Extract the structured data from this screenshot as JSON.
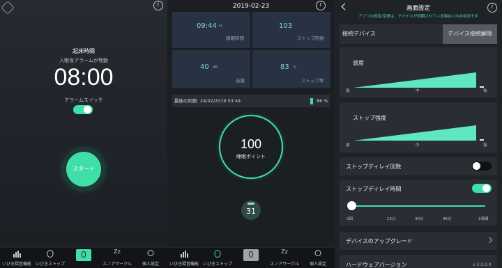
{
  "screen1": {
    "wake_label": "起床時間",
    "alarm_note": "入眠後アラームが発動",
    "time": "08:00",
    "alarm_switch_label": "アラームスイッチ",
    "alarm_on": true,
    "start_label": "スタート"
  },
  "nav": {
    "items": [
      "いびき録音機能",
      "いびきストップ",
      "",
      "スノアサークル",
      "個人設定"
    ]
  },
  "screen2": {
    "date": "2019-02-23",
    "cells": [
      {
        "value": "09:44",
        "unit": "H",
        "label": "睡眠時間"
      },
      {
        "value": "103",
        "unit": "",
        "label": "ストップ回数"
      },
      {
        "value": "40",
        "unit": "dB",
        "label": "音量"
      },
      {
        "value": "83",
        "unit": "%",
        "label": "ストップ率"
      }
    ],
    "sync_label": "最後の同期",
    "sync_time": "24/02/2019 03:44",
    "battery": "86 %",
    "score": "100",
    "score_label": "睡眠ポイント",
    "day": "31"
  },
  "screen3": {
    "title": "画面設定",
    "note": "アプリの設定/変更は、デバイスが同期されている場合にのみ有効です",
    "device_label": "接続デバイス",
    "disconnect": "デバイス接続解除",
    "sensitivity": {
      "label": "感度",
      "ticks": [
        "弱",
        "中",
        "強"
      ]
    },
    "strength": {
      "label": "ストップ強度",
      "ticks": [
        "弱",
        "中",
        "強"
      ]
    },
    "delay_count": {
      "label": "ストップディレイ回数",
      "on": false
    },
    "delay_time": {
      "label": "ストップディレイ時間",
      "on": true,
      "ticks": [
        "0回",
        "15分",
        "30分",
        "45分",
        "1時間"
      ],
      "value_fraction": 0
    },
    "upgrade": "デバイスのアップグレード",
    "hw_label": "ハードウェアバージョン",
    "hw_version": "v 3.0.0.0"
  },
  "colors": {
    "accent": "#3fe0a8",
    "teal": "#5fe6c2",
    "card": "#293242"
  }
}
